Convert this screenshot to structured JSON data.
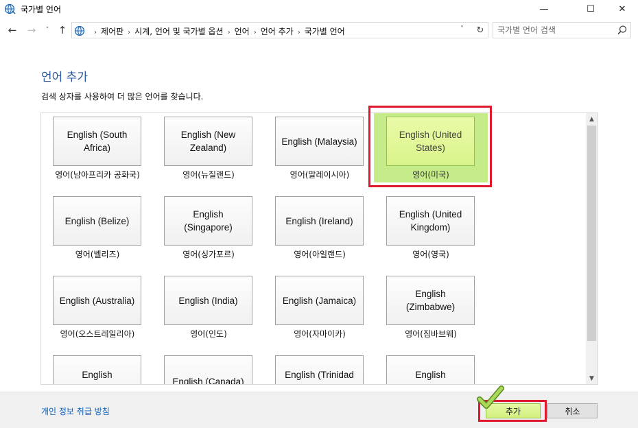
{
  "window": {
    "title": "국가별 언어",
    "controls": {
      "minimize": "—",
      "maximize": "☐",
      "close": "✕"
    }
  },
  "nav": {
    "back": "←",
    "forward": "→",
    "recent": "˅",
    "up": "↑",
    "breadcrumb": [
      "제어판",
      "시계, 언어 및 국가별 옵션",
      "언어",
      "언어 추가",
      "국가별 언어"
    ],
    "separator": "›",
    "address_dropdown": "˅",
    "refresh": "↻",
    "search_placeholder": "국가별 언어 검색"
  },
  "main": {
    "title": "언어 추가",
    "description": "검색 상자를 사용하여 더 많은 언어를 찾습니다.",
    "tiles": [
      {
        "label": "English (South Africa)",
        "caption": "영어(남아프리카 공화국)"
      },
      {
        "label": "English (New Zealand)",
        "caption": "영어(뉴질랜드)"
      },
      {
        "label": "English (Malaysia)",
        "caption": "영어(말레이시아)"
      },
      {
        "label": "English (United States)",
        "caption": "영어(미국)",
        "selected": true
      },
      {
        "label": "English (Belize)",
        "caption": "영어(벨리즈)"
      },
      {
        "label": "English (Singapore)",
        "caption": "영어(싱가포르)"
      },
      {
        "label": "English (Ireland)",
        "caption": "영어(아일랜드)"
      },
      {
        "label": "English (United Kingdom)",
        "caption": "영어(영국)"
      },
      {
        "label": "English (Australia)",
        "caption": "영어(오스트레일리아)"
      },
      {
        "label": "English (India)",
        "caption": "영어(인도)"
      },
      {
        "label": "English (Jamaica)",
        "caption": "영어(자마이카)"
      },
      {
        "label": "English (Zimbabwe)",
        "caption": "영어(짐바브웨)"
      },
      {
        "label": "English",
        "caption": ""
      },
      {
        "label": "English (Canada)",
        "caption": ""
      },
      {
        "label": "English (Trinidad",
        "caption": ""
      },
      {
        "label": "English",
        "caption": ""
      }
    ],
    "scroll_up": "▲",
    "scroll_down": "▼"
  },
  "footer": {
    "privacy_link": "개인 정보 취급 방침",
    "add_button": "추가",
    "cancel_button": "취소"
  },
  "colors": {
    "title_blue": "#2c5aa0",
    "link_blue": "#0a5fbf",
    "selection_green": "#c6ec8a",
    "annotation_red": "#e0182d"
  }
}
